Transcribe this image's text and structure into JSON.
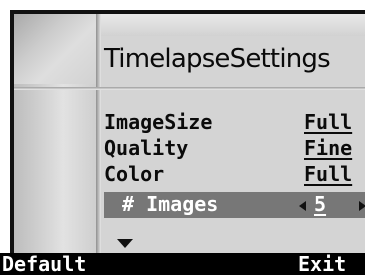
{
  "screen": {
    "title": "TimelapseSettings"
  },
  "settings": [
    {
      "label": "ImageSize",
      "value": "Full"
    },
    {
      "label": "Quality",
      "value": "Fine"
    },
    {
      "label": "Color",
      "value": "Full"
    },
    {
      "label": "# Images",
      "value": "5"
    }
  ],
  "softkeys": {
    "left": "Default",
    "right": "Exit"
  },
  "icons": {
    "scroll_more": "down-arrow-icon",
    "decrease": "left-arrow-icon",
    "increase": "right-arrow-icon"
  }
}
